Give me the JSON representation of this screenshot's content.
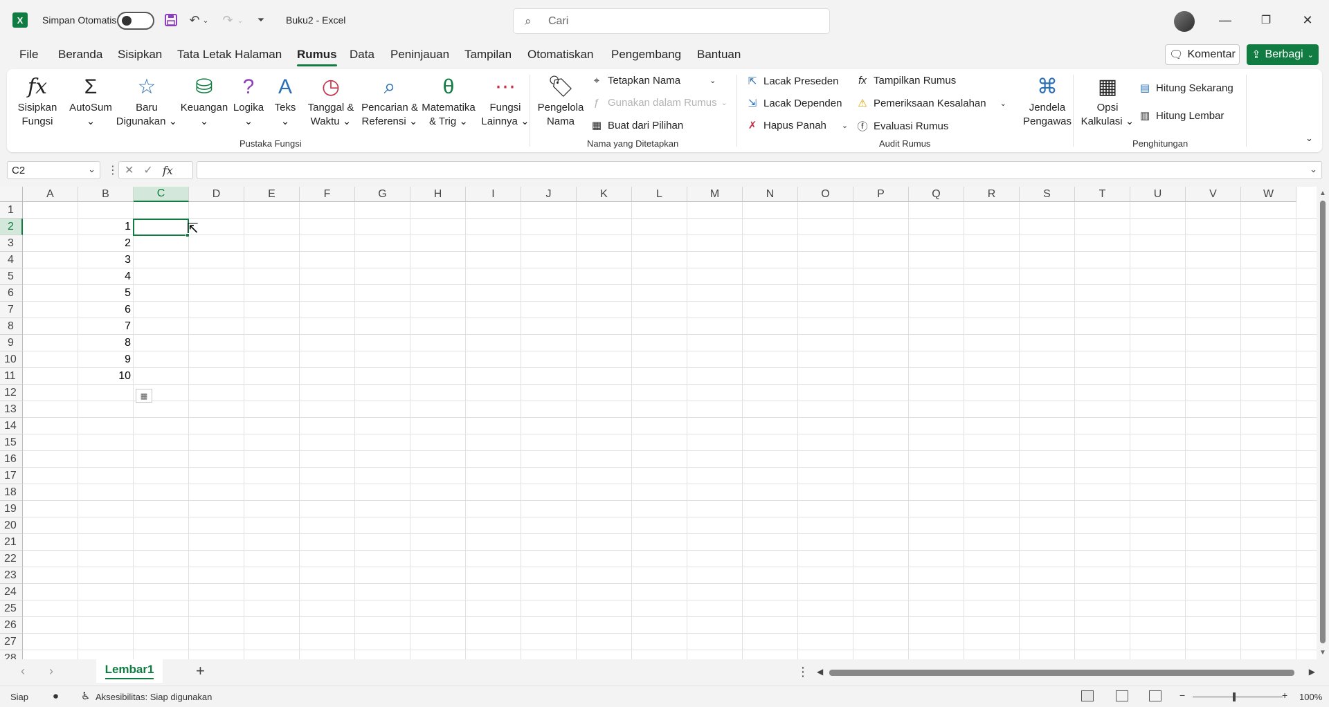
{
  "titlebar": {
    "autosave_label": "Simpan Otomatis",
    "doc_title": "Buku2  -  Excel",
    "search_placeholder": "Cari",
    "minimize": "—",
    "restore": "❐",
    "close": "✕"
  },
  "tabs": [
    "File",
    "Beranda",
    "Sisipkan",
    "Tata Letak Halaman",
    "Rumus",
    "Data",
    "Peninjauan",
    "Tampilan",
    "Otomatiskan",
    "Pengembang",
    "Bantuan"
  ],
  "active_tab": "Rumus",
  "buttons": {
    "komentar": "Komentar",
    "berbagi": "Berbagi"
  },
  "ribbon": {
    "pustaka": {
      "label": "Pustaka Fungsi",
      "items": [
        {
          "label": "Sisipkan\nFungsi",
          "icon": "fx"
        },
        {
          "label": "AutoSum\n⌄",
          "icon": "Σ"
        },
        {
          "label": "Baru\nDigunakan ⌄",
          "icon": "☆"
        },
        {
          "label": "Keuangan\n⌄",
          "icon": "⛁"
        },
        {
          "label": "Logika\n⌄",
          "icon": "?"
        },
        {
          "label": "Teks\n⌄",
          "icon": "A"
        },
        {
          "label": "Tanggal &\nWaktu ⌄",
          "icon": "◷"
        },
        {
          "label": "Pencarian &\nReferensi ⌄",
          "icon": "⌕"
        },
        {
          "label": "Matematika\n& Trig ⌄",
          "icon": "θ"
        },
        {
          "label": "Fungsi\nLainnya ⌄",
          "icon": "⋯"
        }
      ]
    },
    "nama": {
      "label": "Nama yang Ditetapkan",
      "pengelola": "Pengelola\nNama",
      "tetapkan": "Tetapkan Nama",
      "gunakan": "Gunakan dalam Rumus",
      "buat": "Buat dari Pilihan"
    },
    "audit": {
      "label": "Audit Rumus",
      "lacak_preseden": "Lacak Preseden",
      "lacak_dependen": "Lacak Dependen",
      "hapus_panah": "Hapus Panah",
      "tampilkan_rumus": "Tampilkan Rumus",
      "pemeriksaan": "Pemeriksaan Kesalahan",
      "evaluasi": "Evaluasi Rumus",
      "jendela": "Jendela\nPengawas"
    },
    "hitung": {
      "label": "Penghitungan",
      "opsi": "Opsi\nKalkulasi ⌄",
      "sekarang": "Hitung Sekarang",
      "lembar": "Hitung Lembar"
    }
  },
  "formula_bar": {
    "name_box": "C2",
    "fx": "fx",
    "value": ""
  },
  "columns": [
    "A",
    "B",
    "C",
    "D",
    "E",
    "F",
    "G",
    "H",
    "I",
    "J",
    "K",
    "L",
    "M",
    "N",
    "O",
    "P",
    "Q",
    "R",
    "S",
    "T",
    "U",
    "V",
    "W"
  ],
  "selected_column": "C",
  "rows": [
    "1",
    "2",
    "3",
    "4",
    "5",
    "6",
    "7",
    "8",
    "9",
    "10",
    "11",
    "12",
    "13",
    "14",
    "15",
    "16",
    "17",
    "18",
    "19",
    "20",
    "21",
    "22",
    "23",
    "24",
    "25",
    "26",
    "27",
    "28"
  ],
  "selected_row": "2",
  "cells_B": [
    "1",
    "2",
    "3",
    "4",
    "5",
    "6",
    "7",
    "8",
    "9",
    "10"
  ],
  "sheet": {
    "name": "Lembar1"
  },
  "status": {
    "ready": "Siap",
    "accessibility": "Aksesibilitas: Siap digunakan",
    "zoom": "100%"
  },
  "colors": {
    "accent": "#107c41"
  }
}
